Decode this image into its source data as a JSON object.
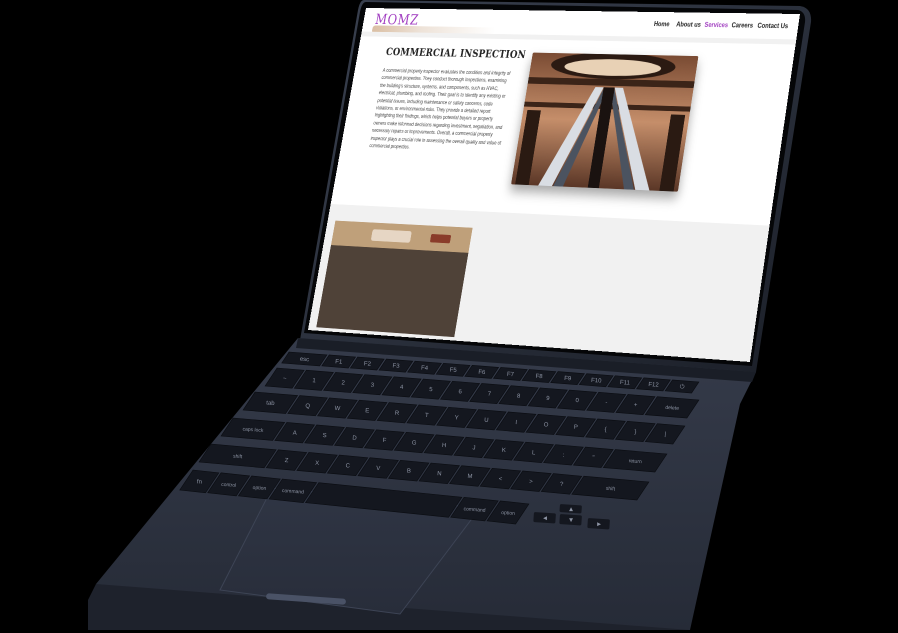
{
  "site": {
    "logo": "MOMZ",
    "nav": [
      "Home",
      "About us",
      "Services",
      "Careers",
      "Contact Us"
    ],
    "active_nav": "Services",
    "title": "COMMERCIAL INSPECTION",
    "body": "A commercial property inspector evaluates the condition and integrity of commercial properties. They conduct thorough inspections, examining the building's structure, systems, and components, such as HVAC, electrical, plumbing, and roofing. Their goal is to identify any existing or potential issues, including maintenance or safety concerns, code violations, or environmental risks. They provide a detailed report highlighting their findings, which helps potential buyers or property owners make informed decisions regarding investment, negotiation, and necessary repairs or improvements. Overall, a commercial property inspector plays a crucial role in assessing the overall quality and value of commercial properties."
  },
  "keyboard": {
    "row_fn": [
      "esc",
      "F1",
      "F2",
      "F3",
      "F4",
      "F5",
      "F6",
      "F7",
      "F8",
      "F9",
      "F10",
      "F11",
      "F12",
      "⏻"
    ],
    "row_num": [
      "~",
      "1",
      "2",
      "3",
      "4",
      "5",
      "6",
      "7",
      "8",
      "9",
      "0",
      "-",
      "+",
      "delete"
    ],
    "row_q": [
      "tab",
      "Q",
      "W",
      "E",
      "R",
      "T",
      "Y",
      "U",
      "I",
      "O",
      "P",
      "{",
      "}",
      "|"
    ],
    "row_a": [
      "caps lock",
      "A",
      "S",
      "D",
      "F",
      "G",
      "H",
      "J",
      "K",
      "L",
      ":",
      "\"",
      "return"
    ],
    "row_z": [
      "shift",
      "Z",
      "X",
      "C",
      "V",
      "B",
      "N",
      "M",
      "<",
      ">",
      "?",
      "shift"
    ],
    "row_mod": [
      "fn",
      "control",
      "option",
      "command",
      "",
      "command",
      "option"
    ],
    "arrows": [
      "▲",
      "◀",
      "▼",
      "▶"
    ]
  },
  "colors": {
    "background": "#000000",
    "aluminum": "#2b3140",
    "key": "#14171f",
    "accent": "#a03cc0"
  }
}
